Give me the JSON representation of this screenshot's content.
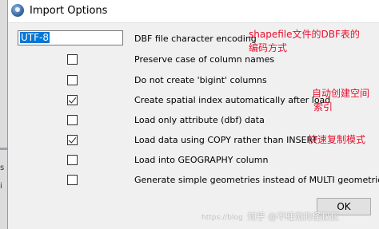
{
  "window": {
    "title": "Import Options"
  },
  "encoding": {
    "value": "UTF-8",
    "label": "DBF file character encoding"
  },
  "options": [
    {
      "label": "Preserve case of column names",
      "checked": false
    },
    {
      "label": "Do not create 'bigint' columns",
      "checked": false
    },
    {
      "label": "Create spatial index automatically after load",
      "checked": true
    },
    {
      "label": "Load only attribute (dbf) data",
      "checked": false
    },
    {
      "label": "Load data using COPY rather than INSERT",
      "checked": true
    },
    {
      "label": "Load into GEOGRAPHY column",
      "checked": false
    },
    {
      "label": "Generate simple geometries instead of MULTI geometries",
      "checked": false
    }
  ],
  "annotations": {
    "encoding_line1": "shapefile文件的DBF表的",
    "encoding_line2": "编码方式",
    "spatial_line1": "自动创建空间",
    "spatial_line2": "索引",
    "copy": "快速复制模式"
  },
  "ok_button": {
    "label": "OK"
  },
  "watermark": {
    "url": "https://blog",
    "text": "知乎 @不睡觉的怪叔叔"
  },
  "left_edge": {
    "text1": "s",
    "text2": "i"
  },
  "colors": {
    "annotation": "#e8102e",
    "selection": "#0078d7"
  }
}
